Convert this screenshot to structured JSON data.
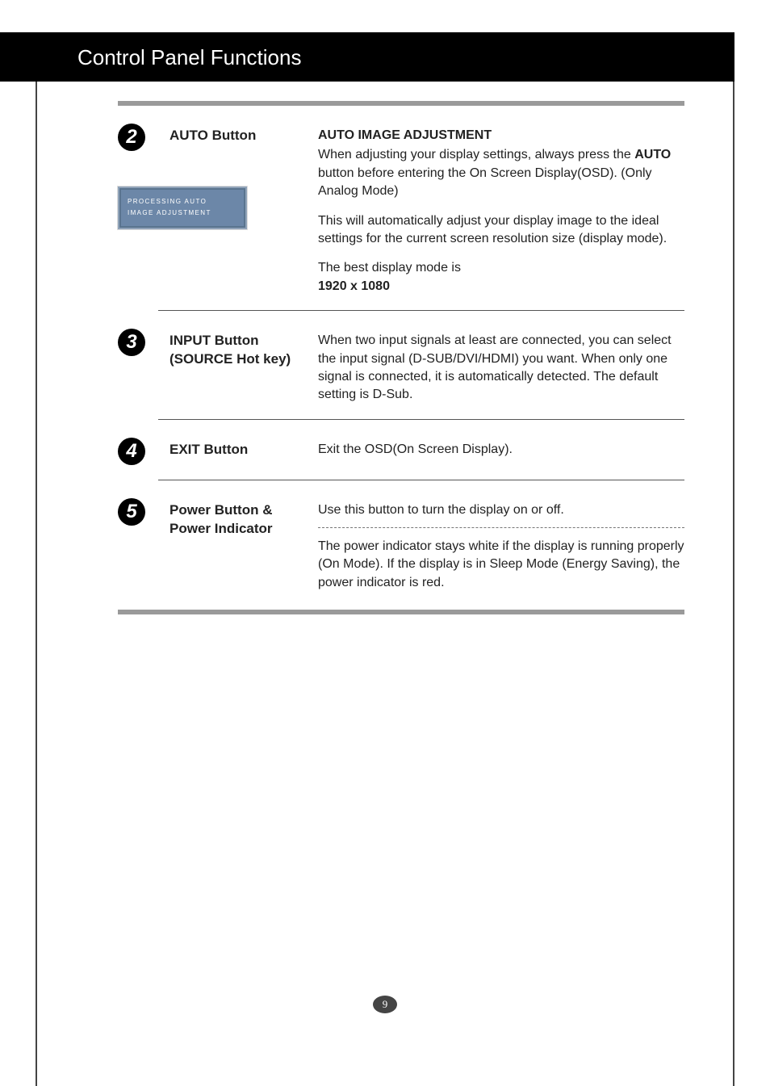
{
  "header": {
    "title": "Control Panel Functions"
  },
  "items": {
    "auto": {
      "number": "2",
      "label": "AUTO Button",
      "osd_line1": "PROCESSING AUTO",
      "osd_line2": "IMAGE ADJUSTMENT",
      "heading": "AUTO IMAGE ADJUSTMENT",
      "p1a": "When adjusting your display settings, always press the ",
      "p1b": "AUTO",
      "p1c": " button before entering the On Screen Display(OSD). (Only Analog Mode)",
      "p2": "This will automatically adjust your display image to the ideal settings for the current screen resolution size (display mode).",
      "p3": "The best display mode is",
      "mode": "1920 x 1080"
    },
    "input": {
      "number": "3",
      "label_line1": "INPUT Button",
      "label_line2": "(SOURCE Hot key)",
      "desc": "When two input signals at least are connected, you can select the input signal (D-SUB/DVI/HDMI) you want. When only one signal is connected, it is automatically detected. The default setting is D-Sub."
    },
    "exit": {
      "number": "4",
      "label": "EXIT Button",
      "desc": "Exit the OSD(On Screen Display)."
    },
    "power": {
      "number": "5",
      "label_line1": "Power Button &",
      "label_line2": "Power Indicator",
      "desc1": "Use this button to turn the display on or off.",
      "desc2": "The power indicator stays white if the display is running properly (On Mode). If the display is in Sleep Mode (Energy Saving), the power indicator is red."
    }
  },
  "page_number": "9"
}
